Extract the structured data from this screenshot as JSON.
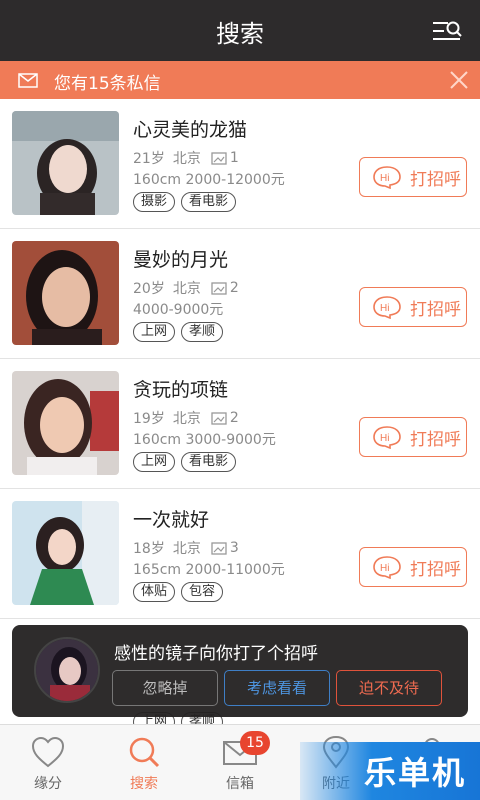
{
  "header": {
    "title": "搜索"
  },
  "notice": {
    "text": "您有15条私信"
  },
  "profiles": [
    {
      "name": "心灵美的龙猫",
      "age": "21岁",
      "city": "北京",
      "photos": "1",
      "stats": "160cm 2000-12000元",
      "tags": [
        "摄影",
        "看电影"
      ],
      "greet": "打招呼"
    },
    {
      "name": "曼妙的月光",
      "age": "20岁",
      "city": "北京",
      "photos": "2",
      "stats": "4000-9000元",
      "tags": [
        "上网",
        "孝顺"
      ],
      "greet": "打招呼"
    },
    {
      "name": "贪玩的项链",
      "age": "19岁",
      "city": "北京",
      "photos": "2",
      "stats": "160cm 3000-9000元",
      "tags": [
        "上网",
        "看电影"
      ],
      "greet": "打招呼"
    },
    {
      "name": "一次就好",
      "age": "18岁",
      "city": "北京",
      "photos": "3",
      "stats": "165cm 2000-11000元",
      "tags": [
        "体贴",
        "包容"
      ],
      "greet": "打招呼"
    },
    {
      "tags": [
        "上网",
        "孝顺"
      ]
    }
  ],
  "toast": {
    "message": "感性的镜子向你打了个招呼",
    "ignore": "忽略掉",
    "consider": "考虑看看",
    "urgent": "迫不及待"
  },
  "tabs": [
    {
      "label": "缘分",
      "icon": "heart-icon"
    },
    {
      "label": "搜索",
      "icon": "search-icon",
      "active": true
    },
    {
      "label": "信箱",
      "icon": "mail-icon",
      "badge": "15"
    },
    {
      "label": "附近",
      "icon": "location-icon"
    },
    {
      "label": "",
      "icon": "user-icon"
    }
  ],
  "watermark": {
    "text": "乐单机"
  },
  "colors": {
    "accent": "#f07b57",
    "header": "#2d2b2c",
    "badge": "#e8452f"
  }
}
